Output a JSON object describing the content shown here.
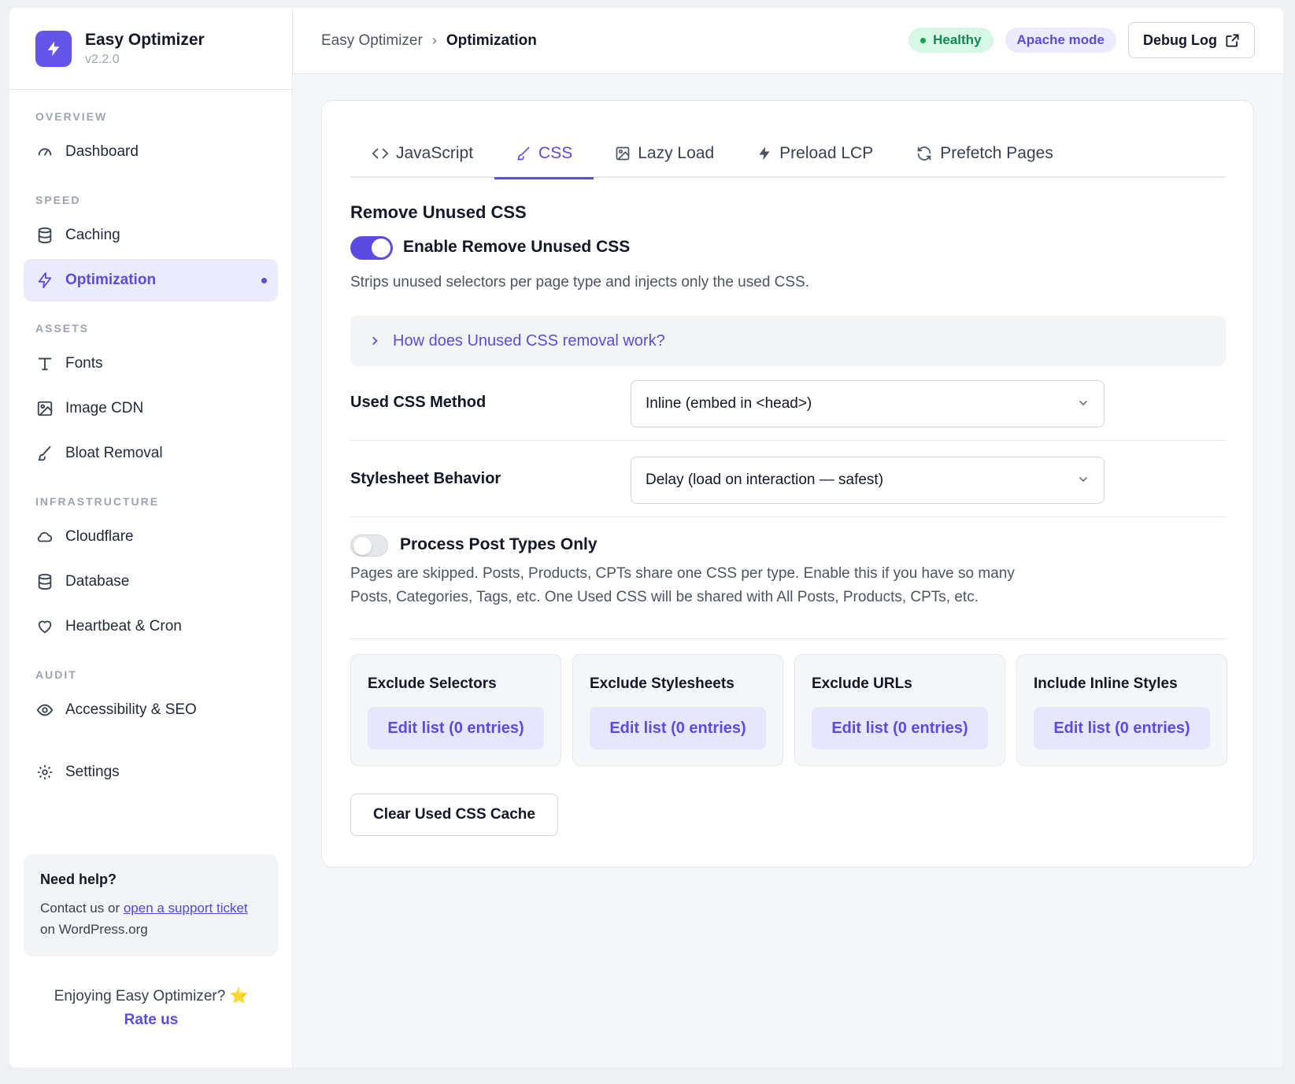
{
  "brand": {
    "name": "Easy Optimizer",
    "version": "v2.2.0"
  },
  "sidebar": {
    "sections": {
      "overview": "OVERVIEW",
      "speed": "SPEED",
      "assets": "ASSETS",
      "infrastructure": "INFRASTRUCTURE",
      "audit": "AUDIT"
    },
    "items": {
      "dashboard": "Dashboard",
      "caching": "Caching",
      "optimization": "Optimization",
      "fonts": "Fonts",
      "image_cdn": "Image CDN",
      "bloat_removal": "Bloat Removal",
      "cloudflare": "Cloudflare",
      "database": "Database",
      "heartbeat": "Heartbeat & Cron",
      "accessibility": "Accessibility & SEO",
      "settings": "Settings"
    },
    "help": {
      "title": "Need help?",
      "prefix": "Contact us or ",
      "link": "open a support ticket",
      "suffix": " on WordPress.org"
    },
    "enjoy": "Enjoying Easy Optimizer? ⭐",
    "rate": "Rate us"
  },
  "header": {
    "breadcrumb_root": "Easy Optimizer",
    "breadcrumb_sep": "›",
    "breadcrumb_current": "Optimization",
    "status_healthy": "Healthy",
    "status_mode": "Apache mode",
    "debug_label": "Debug Log"
  },
  "tabs": {
    "javascript": "JavaScript",
    "css": "CSS",
    "lazy_load": "Lazy Load",
    "preload_lcp": "Preload LCP",
    "prefetch": "Prefetch Pages"
  },
  "css_panel": {
    "title": "Remove Unused CSS",
    "enable_label": "Enable Remove Unused CSS",
    "enable_desc": "Strips unused selectors per page type and injects only the used CSS.",
    "accordion": "How does Unused CSS removal work?",
    "method_label": "Used CSS Method",
    "method_value": "Inline (embed in <head>)",
    "behavior_label": "Stylesheet Behavior",
    "behavior_value": "Delay (load on interaction — safest)",
    "post_types_label": "Process Post Types Only",
    "post_types_desc_1": "Pages are skipped. Posts, Products, CPTs share one CSS per type. Enable this if you have so many",
    "post_types_desc_2": "Posts, Categories, Tags, etc. One Used CSS will be shared with All Posts, Products, CPTs, etc.",
    "exclude_selectors": "Exclude Selectors",
    "exclude_stylesheets": "Exclude Stylesheets",
    "exclude_urls": "Exclude URLs",
    "include_inline": "Include Inline Styles",
    "edit_list": "Edit list (0 entries)",
    "clear_cache": "Clear Used CSS Cache"
  },
  "colors": {
    "accent": "#5b4be0",
    "healthy": "#16a34a"
  }
}
